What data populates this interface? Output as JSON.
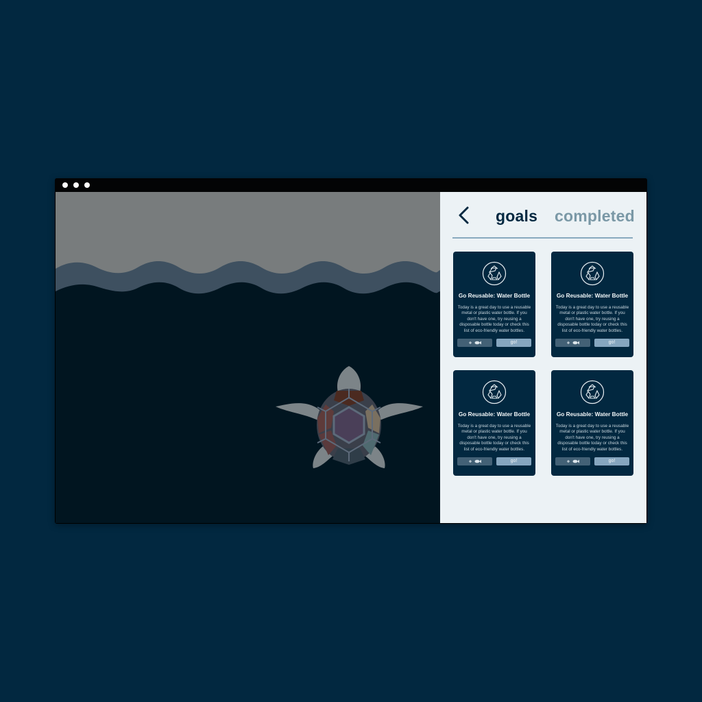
{
  "panel": {
    "tabs": [
      {
        "label": "goals"
      },
      {
        "label": "completed"
      }
    ]
  },
  "cards": [
    {
      "icon": "recycle-icon",
      "title": "Go Reusable: Water Bottle",
      "text": "Today is a great day to use a reusable metal or plastic water bottle. If you don't have one, try reusing a disposable bottle today or check this list of eco-friendly water bottles.",
      "reward_icons": [
        "plus-icon",
        "fish-icon"
      ],
      "go_label": "go!"
    },
    {
      "icon": "recycle-icon",
      "title": "Go Reusable: Water Bottle",
      "text": "Today is a great day to use a reusable metal or plastic water bottle. If you don't have one, try reusing a disposable bottle today or check this list of eco-friendly water bottles.",
      "reward_icons": [
        "plus-icon",
        "fish-icon"
      ],
      "go_label": "go!"
    },
    {
      "icon": "recycle-icon",
      "title": "Go Reusable: Water Bottle",
      "text": "Today is a great day to use a reusable metal or plastic water bottle. If you don't have one, try reusing a disposable bottle today or check this list of eco-friendly water bottles.",
      "reward_icons": [
        "plus-icon",
        "fish-icon"
      ],
      "go_label": "go!"
    },
    {
      "icon": "recycle-icon",
      "title": "Go Reusable: Water Bottle",
      "text": "Today is a great day to use a reusable metal or plastic water bottle. If you don't have one, try reusing a disposable bottle today or check this list of eco-friendly water bottles.",
      "reward_icons": [
        "plus-icon",
        "fish-icon"
      ],
      "go_label": "go!"
    }
  ],
  "colors": {
    "page_background": "#022840",
    "sky": "#787c7d",
    "wave": "#3e5060",
    "ocean": "#011520",
    "panel_background": "#ecf2f5",
    "card_background": "#022840",
    "accent": "#86a6bf",
    "tab_active": "#022840",
    "tab_inactive": "#7a98a6"
  }
}
